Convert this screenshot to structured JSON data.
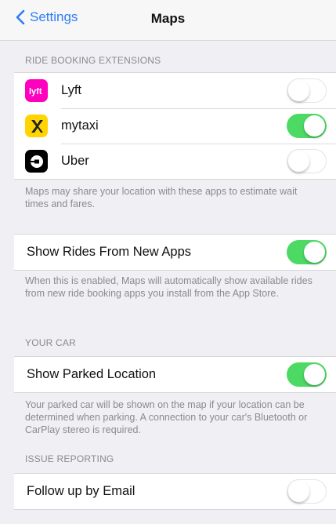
{
  "nav": {
    "back_label": "Settings",
    "title": "Maps"
  },
  "sections": {
    "ride_booking": {
      "header": "RIDE BOOKING EXTENSIONS",
      "items": [
        {
          "label": "Lyft",
          "icon": "lyft-icon",
          "on": false
        },
        {
          "label": "mytaxi",
          "icon": "mytaxi-icon",
          "on": true
        },
        {
          "label": "Uber",
          "icon": "uber-icon",
          "on": false
        }
      ],
      "footer": "Maps may share your location with these apps to estimate wait times and fares."
    },
    "new_apps": {
      "label": "Show Rides From New Apps",
      "on": true,
      "footer": "When this is enabled, Maps will automatically show available rides from new ride booking apps you install from the App Store."
    },
    "your_car": {
      "header": "YOUR CAR",
      "label": "Show Parked Location",
      "on": true,
      "footer": "Your parked car will be shown on the map if your location can be determined when parking. A connection to your car's Bluetooth or CarPlay stereo is required."
    },
    "issue_reporting": {
      "header": "ISSUE REPORTING",
      "label": "Follow up by Email",
      "on": false
    }
  },
  "colors": {
    "accent": "#2f7cf6",
    "toggle_on": "#4cd964",
    "background": "#efeff4"
  }
}
